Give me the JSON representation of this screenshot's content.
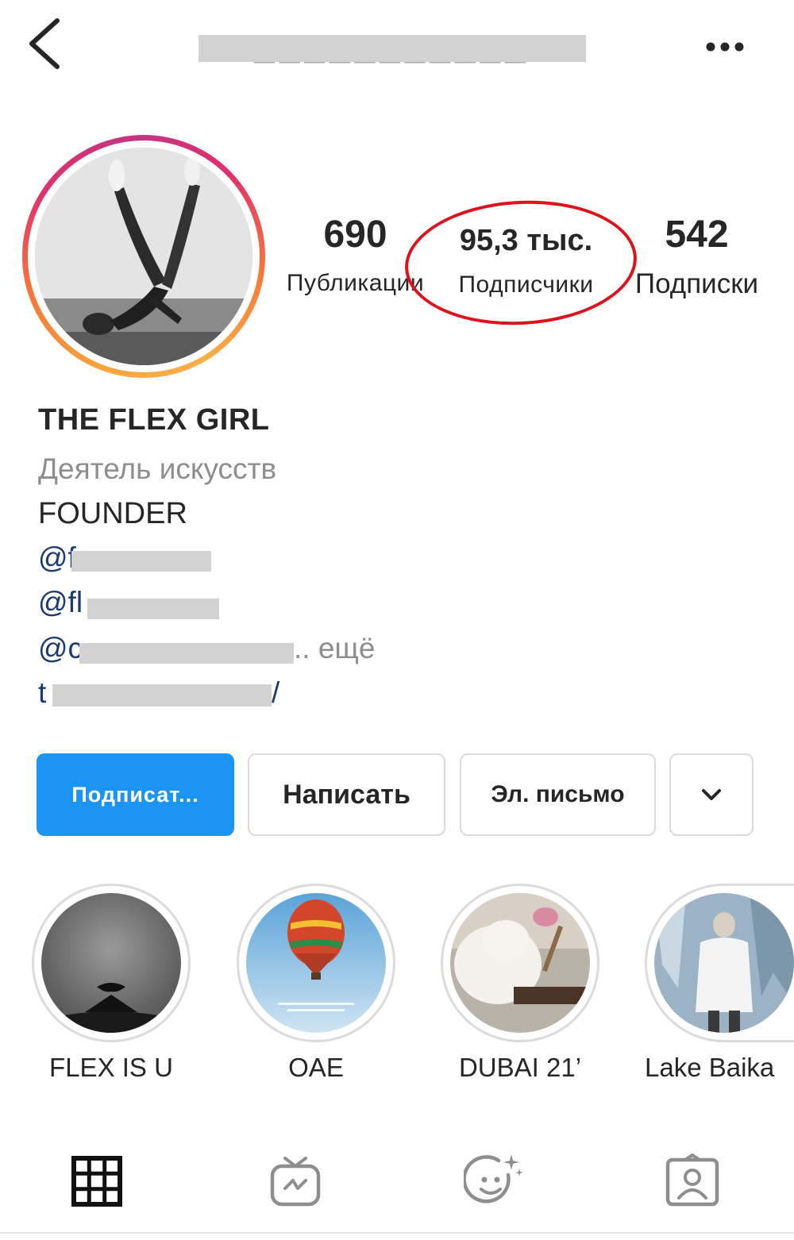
{
  "header": {
    "back_icon": "chevron-left-icon",
    "username_hidden": "___________",
    "more_icon": "more-horizontal-icon"
  },
  "profile": {
    "stats": {
      "posts_count": "690",
      "posts_label": "Публикации",
      "followers_count": "95,3 тыс.",
      "followers_label": "Подписчики",
      "following_count": "542",
      "following_label": "Подписки"
    },
    "bio": {
      "name": "THE FLEX GIRL",
      "category": "Деятель искусств",
      "line1": "FOUNDER",
      "mention1": "@f",
      "mention2": "@fl",
      "mention3": "@c",
      "mention3_suffix": ".. ещё",
      "link": "t",
      "link_suffix": "/"
    }
  },
  "buttons": {
    "follow": "Подписат...",
    "message": "Написать",
    "email": "Эл. письмо",
    "dropdown_icon": "chevron-down-icon"
  },
  "highlights": [
    {
      "label": "FLEX IS U"
    },
    {
      "label": "OAE"
    },
    {
      "label": "DUBAI 21’"
    },
    {
      "label": "Lake Baika"
    }
  ],
  "tabs": [
    {
      "icon": "grid-icon",
      "active": true
    },
    {
      "icon": "igtv-icon",
      "active": false
    },
    {
      "icon": "reels-effects-icon",
      "active": false
    },
    {
      "icon": "tagged-icon",
      "active": false
    }
  ],
  "colors": {
    "follow_button": "#1a95f4",
    "annotation_oval": "#e0111b",
    "link_text": "#1c3a6e",
    "muted_text": "#8e8e8e"
  }
}
